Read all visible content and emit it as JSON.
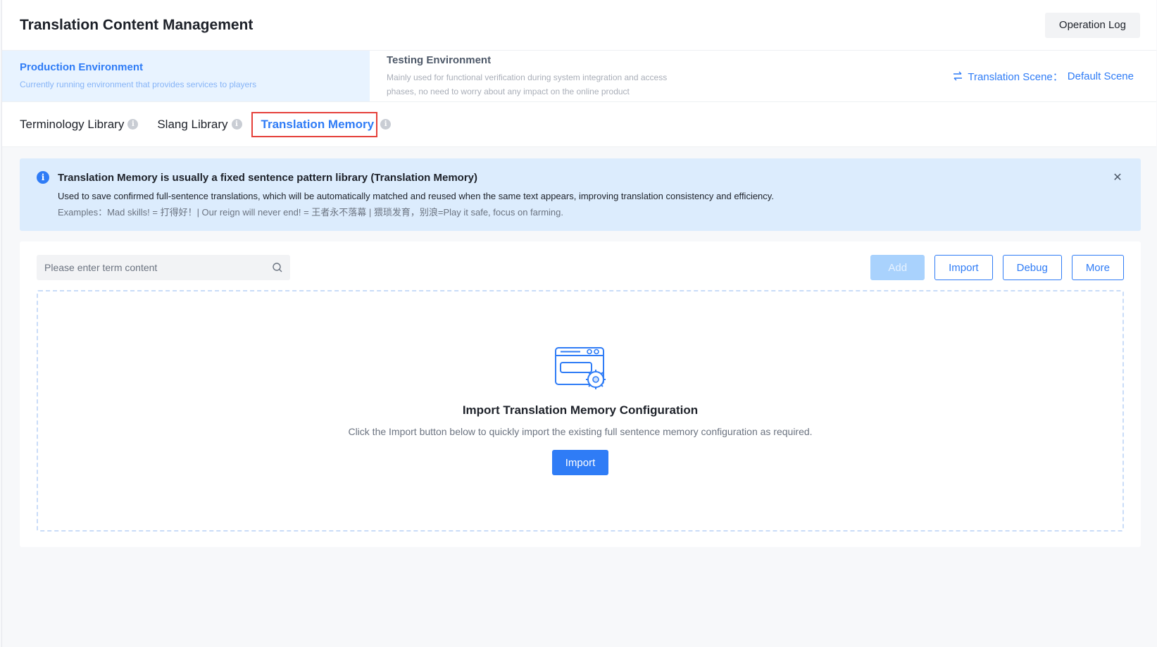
{
  "header": {
    "title": "Translation Content Management",
    "operation_log_label": "Operation Log"
  },
  "environments": {
    "production": {
      "name": "Production Environment",
      "desc": "Currently running environment that provides services to players"
    },
    "testing": {
      "name": "Testing Environment",
      "desc": "Mainly used for functional verification during system integration and access phases, no need to worry about any impact on the online product"
    },
    "scene_label": "Translation Scene：",
    "scene_value": "Default Scene"
  },
  "tabs": [
    {
      "label": "Terminology Library"
    },
    {
      "label": "Slang Library"
    },
    {
      "label": "Translation Memory"
    }
  ],
  "alert": {
    "title": "Translation Memory is usually a fixed sentence pattern library (Translation Memory)",
    "body": "Used to save confirmed full-sentence translations, which will be automatically matched and reused when the same text appears, improving translation consistency and efficiency.",
    "example": "Examples：Mad skills! = 打得好！| Our reign will never end! = 王者永不落幕 | 猥琐发育，别浪=Play it safe, focus on farming.",
    "close_glyph": "✕"
  },
  "toolbar": {
    "search_placeholder": "Please enter term content",
    "add_label": "Add",
    "import_label": "Import",
    "debug_label": "Debug",
    "more_label": "More"
  },
  "empty_state": {
    "title": "Import Translation Memory Configuration",
    "desc": "Click the Import button below to quickly import the existing full sentence memory configuration as required.",
    "import_label": "Import"
  },
  "colors": {
    "primary": "#2f7cf6",
    "active_env_bg": "#e8f3ff",
    "alert_bg": "#dcecfd",
    "tab_highlight_border": "#e5403a"
  },
  "icons": {
    "info": "info-icon",
    "search": "search-icon",
    "swap": "swap-icon",
    "close": "close-icon",
    "illustration": "config-window-gear-icon"
  }
}
